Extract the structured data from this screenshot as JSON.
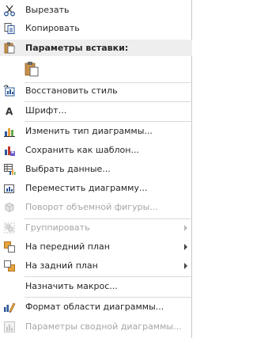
{
  "menu": {
    "cut": "Вырезать",
    "copy": "Копировать",
    "paste_header": "Параметры вставки:",
    "restore_style": "Восстановить стиль",
    "font": "Шрифт...",
    "change_chart_type": "Изменить тип диаграммы...",
    "save_as_template": "Сохранить как шаблон...",
    "select_data": "Выбрать данные...",
    "move_chart": "Переместить диаграмму...",
    "rotate_3d": "Поворот объемной фигуры...",
    "group": "Группировать",
    "bring_forward": "На передний план",
    "send_backward": "На задний план",
    "assign_macro": "Назначить макрос...",
    "format_chart_area": "Формат области диаграммы...",
    "pivot_chart_options": "Параметры сводной диаграммы..."
  },
  "colors": {
    "header_bg": "#eeeeee",
    "disabled_text": "#a6a6a6",
    "accent_blue": "#2b579a",
    "accent_orange": "#e8a33d"
  }
}
